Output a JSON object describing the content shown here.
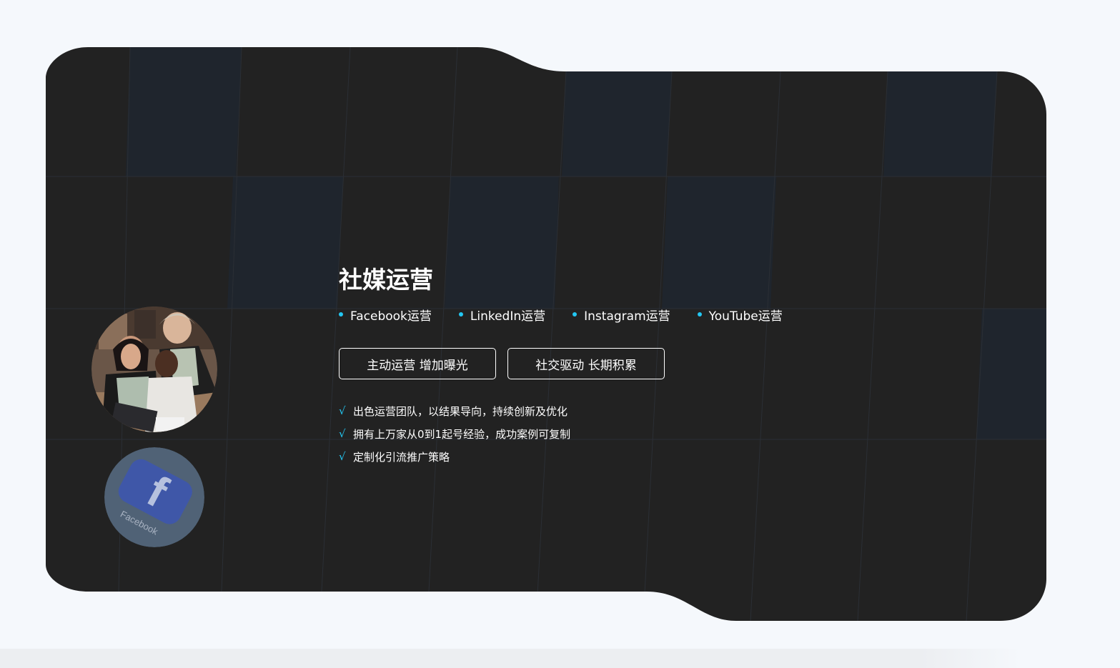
{
  "section": {
    "title": "社媒运营",
    "platforms": [
      "Facebook运营",
      "LinkedIn运营",
      "Instagram运营",
      "YouTube运营"
    ],
    "buttons": [
      "主动运营 增加曝光",
      "社交驱动 长期积累"
    ],
    "check_mark": "√",
    "features": [
      "出色运营团队，以结果导向，持续创新及优化",
      "拥有上万家从0到1起号经验，成功案例可复制",
      "定制化引流推广策略"
    ]
  },
  "colors": {
    "page_background": "#f5f8fc",
    "panel_background": "#222222",
    "panel_tile": "#1f252d",
    "accent": "#23c7f2",
    "text": "#ffffff"
  },
  "images": {
    "photo": "team-working-at-laptop-photo",
    "facebook_icon": "facebook-app-icon"
  }
}
